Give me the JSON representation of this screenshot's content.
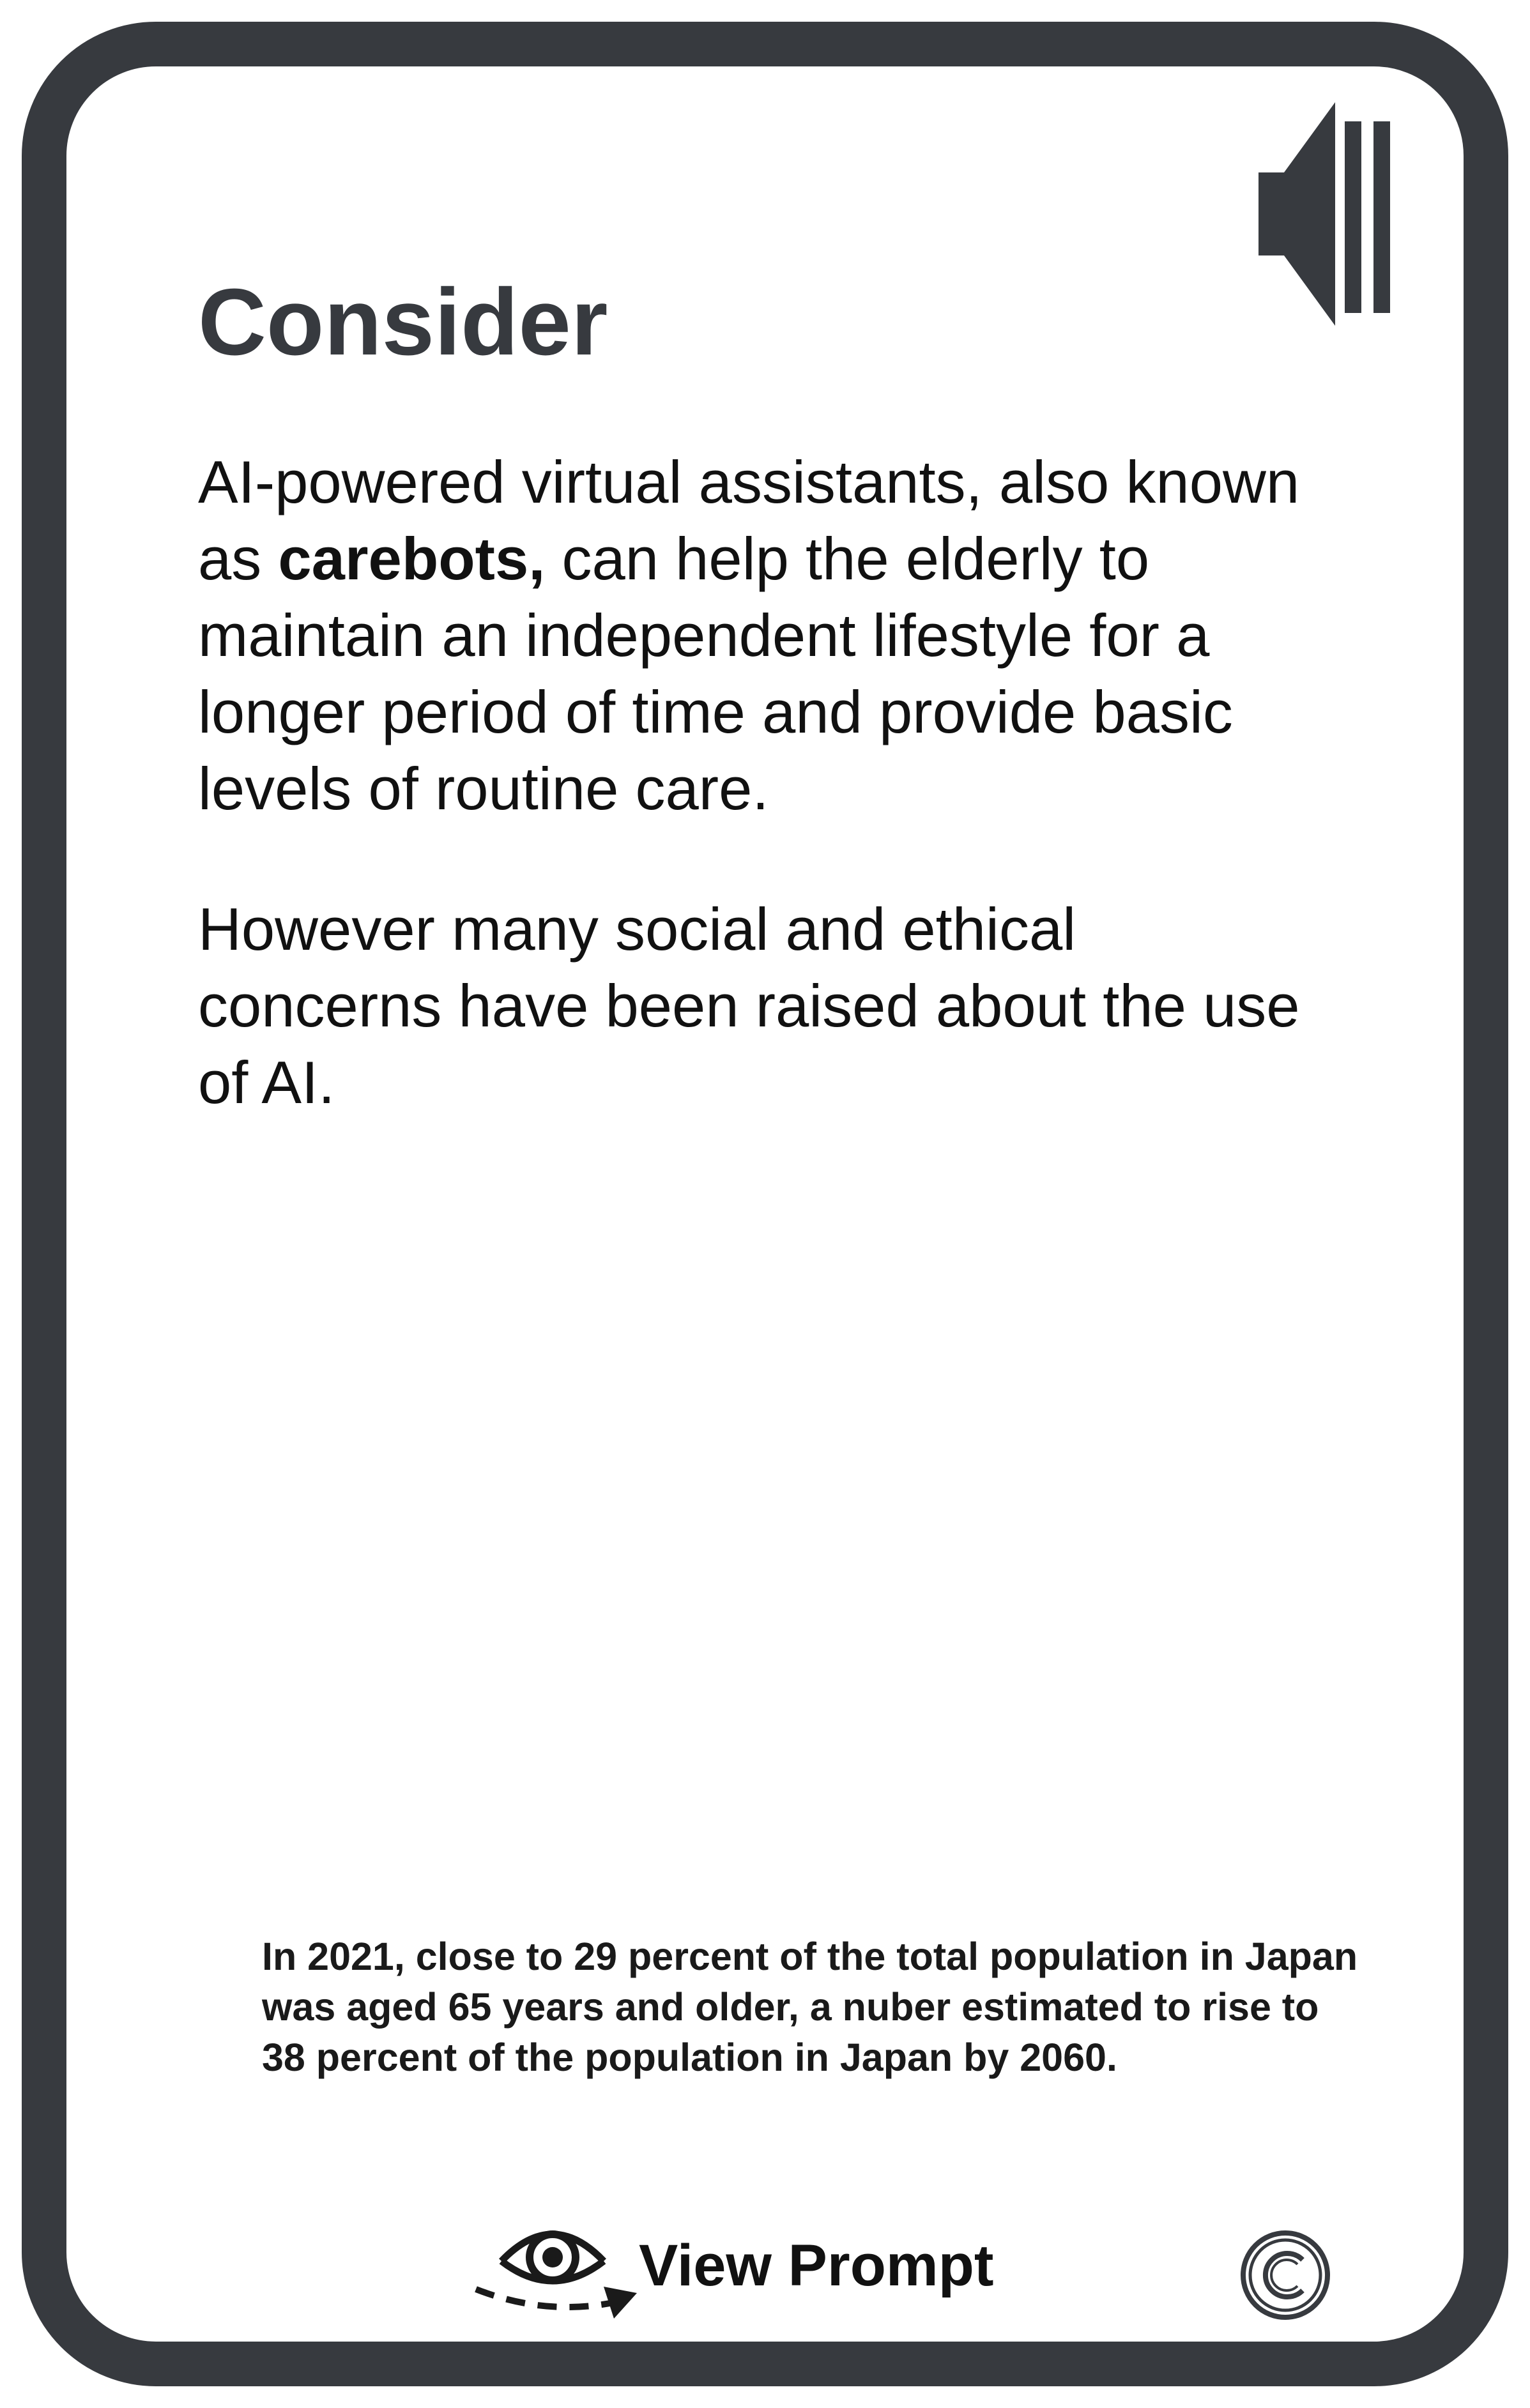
{
  "card": {
    "title": "Consider",
    "paragraph1": {
      "before_bold": "AI-powered virtual assistants, also known as ",
      "bold": "carebots,",
      "after_bold": " can help the elderly to maintain an independent lifestyle for a longer period of time and provide basic levels of routine care."
    },
    "paragraph2": "However many social and ethical concerns have been raised about the use of AI.",
    "fact": "In 2021, close to 29 percent of the total population in Japan was aged 65 years and older, a nuber estimated to rise to 38 percent of the population in Japan by 2060.",
    "view_prompt_label": "View Prompt"
  },
  "icons": {
    "audio": "speaker-icon",
    "view_prompt": "eye-icon",
    "copyright": "copyright-icon"
  },
  "colors": {
    "frame": "#373a3f",
    "text": "#111111",
    "background": "#ffffff"
  }
}
